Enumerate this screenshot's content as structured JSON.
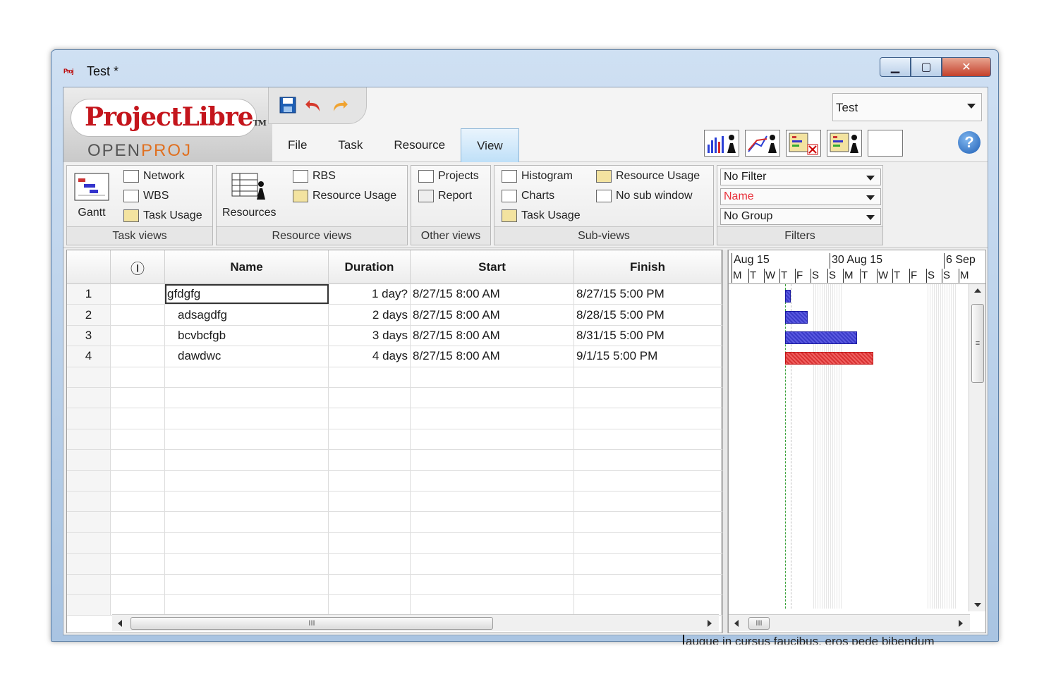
{
  "window": {
    "title": "Test *",
    "app_icon_text": "Proj",
    "minimize": "▁",
    "maximize": "▢",
    "close": "✕"
  },
  "logo": {
    "main": "ProjectLibre",
    "tm": "TM",
    "sub_prefix": "OPEN",
    "sub_suffix": "PROJ"
  },
  "quick_access": {
    "save_icon": "save-icon",
    "undo_icon": "undo-icon",
    "redo_icon": "redo-icon"
  },
  "tabs": [
    {
      "label": "File"
    },
    {
      "label": "Task"
    },
    {
      "label": "Resource"
    },
    {
      "label": "View"
    }
  ],
  "project_selector": {
    "value": "Test"
  },
  "groups": {
    "task_views": {
      "caption": "Task views",
      "gantt": "Gantt",
      "network": "Network",
      "wbs": "WBS",
      "task_usage": "Task Usage"
    },
    "resource_views": {
      "caption": "Resource views",
      "resources": "Resources",
      "rbs": "RBS",
      "resource_usage": "Resource Usage"
    },
    "other_views": {
      "caption": "Other views",
      "projects": "Projects",
      "report": "Report"
    },
    "sub_views": {
      "caption": "Sub-views",
      "histogram": "Histogram",
      "charts": "Charts",
      "task_usage": "Task Usage",
      "resource_usage": "Resource Usage",
      "no_sub_window": "No sub window"
    },
    "filters": {
      "caption": "Filters",
      "filter": "No Filter",
      "sort": "Name",
      "group": "No Group"
    }
  },
  "colors": {
    "sort_text": "#e8303a",
    "critical_bar": "#d83232",
    "normal_bar": "#3a3ac8"
  },
  "grid": {
    "headers": {
      "indicator": "Ⓘ",
      "name": "Name",
      "duration": "Duration",
      "start": "Start",
      "finish": "Finish"
    },
    "rows": [
      {
        "num": "1",
        "name": "gfdgfg",
        "duration": "1 day?",
        "start": "8/27/15 8:00 AM",
        "finish": "8/27/15 5:00 PM"
      },
      {
        "num": "2",
        "name": "adsagdfg",
        "duration": "2 days",
        "start": "8/27/15 8:00 AM",
        "finish": "8/28/15 5:00 PM"
      },
      {
        "num": "3",
        "name": "bcvbcfgb",
        "duration": "3 days",
        "start": "8/27/15 8:00 AM",
        "finish": "8/31/15 5:00 PM"
      },
      {
        "num": "4",
        "name": "dawdwc",
        "duration": "4 days",
        "start": "8/27/15 8:00 AM",
        "finish": "9/1/15 5:00 PM"
      }
    ],
    "scroll_grip": "III"
  },
  "gantt": {
    "weeks": [
      "Aug 15",
      "30 Aug 15",
      "6 Sep"
    ],
    "days": [
      "M",
      "T",
      "W",
      "T",
      "F",
      "S",
      "S",
      "M",
      "T",
      "W",
      "T",
      "F",
      "S",
      "S",
      "M"
    ],
    "scroll_grip": "III",
    "vscroll_grip": "≡"
  },
  "below_text": "augue in cursus faucibus, eros pede bibendum"
}
